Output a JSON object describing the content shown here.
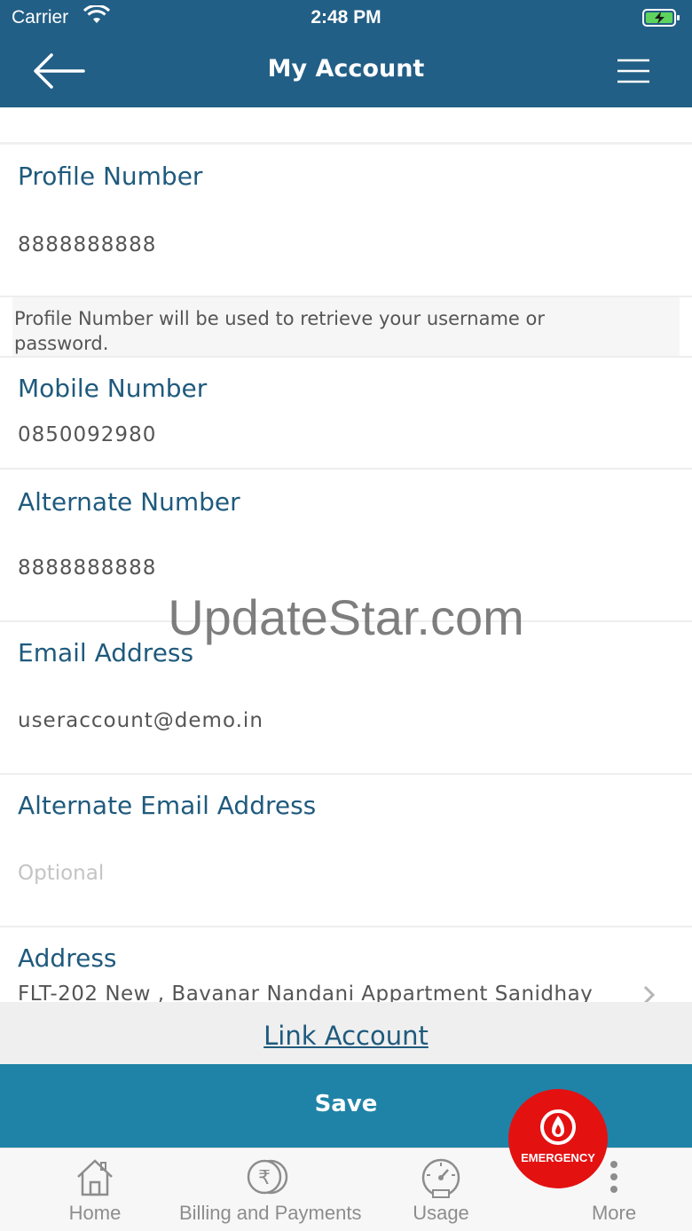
{
  "status_bar": {
    "carrier": "Carrier",
    "time": "2:48 PM"
  },
  "header": {
    "title": "My Account"
  },
  "fields": [
    {
      "label": "Profile Number",
      "value": "8888888888"
    },
    {
      "label": "Mobile Number",
      "value": "0850092980"
    },
    {
      "label": "Alternate Number",
      "value": "8888888888"
    },
    {
      "label": "Email Address",
      "value": "useraccount@demo.in"
    },
    {
      "label": "Alternate Email Address",
      "placeholder": "Optional"
    },
    {
      "label": "Address",
      "value": "FLT-202 New , Bavanar Nandani Appartment Sanidhay"
    }
  ],
  "profile_note": "Profile Number will be used to retrieve your username or password.",
  "link_account": "Link Account",
  "save_label": "Save",
  "emergency_label": "EMERGENCY",
  "tabs": [
    {
      "label": "Home",
      "icon": "home-icon"
    },
    {
      "label": "Billing and Payments",
      "icon": "rupee-coin-icon"
    },
    {
      "label": "Usage",
      "icon": "gauge-icon"
    },
    {
      "label": "More",
      "icon": "more-vertical-icon"
    }
  ],
  "watermark": "UpdateStar.com",
  "colors": {
    "header": "#225f86",
    "save": "#1f83a7",
    "label": "#1f5a7d",
    "emergency": "#e41111"
  }
}
